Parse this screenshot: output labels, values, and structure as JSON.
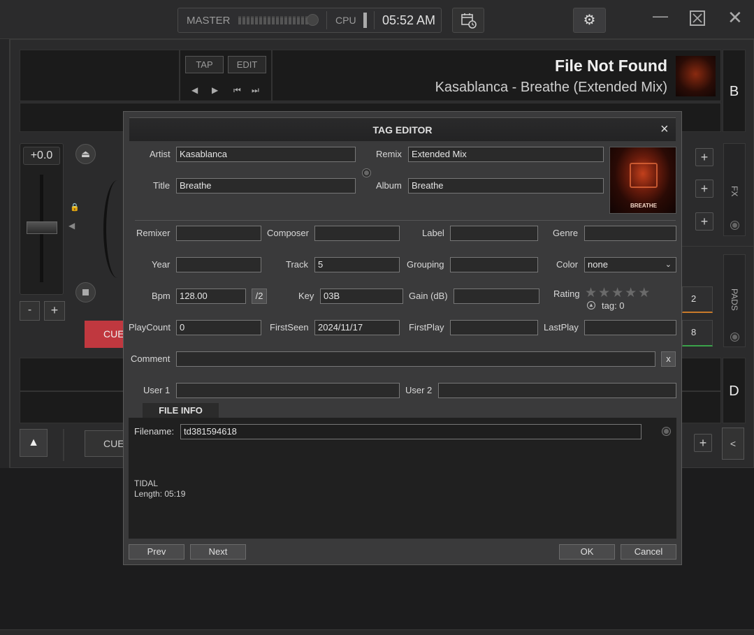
{
  "topbar": {
    "master_label": "MASTER",
    "cpu_label": "CPU",
    "clock": "05:52 AM",
    "icons": [
      "calendar-clock-icon",
      "gear-icon",
      "minimize-icon",
      "restore-icon",
      "close-icon"
    ]
  },
  "deck_top": {
    "tap_label": "TAP",
    "edit_label": "EDIT",
    "track_title": "File Not Found",
    "track_subtitle": "Kasablanca - Breathe (Extended Mix)",
    "deck_letter": "B",
    "pitch_value": "+0.0",
    "cue_label": "CUE",
    "minus_label": "-",
    "plus_label": "+"
  },
  "right_panel": {
    "fx_label": "FX",
    "pads_label": "PADS",
    "pad_2": "2",
    "pad_8": "8"
  },
  "deck_bottom": {
    "deck_letter": "D",
    "cue_label": "CUE",
    "collapse_label": "<"
  },
  "dialog": {
    "title": "TAG EDITOR",
    "close_label": "×",
    "artwork_text": "BREATHE",
    "fields": {
      "artist": {
        "label": "Artist",
        "value": "Kasablanca"
      },
      "title": {
        "label": "Title",
        "value": "Breathe"
      },
      "remix": {
        "label": "Remix",
        "value": "Extended Mix"
      },
      "album": {
        "label": "Album",
        "value": "Breathe"
      },
      "remixer": {
        "label": "Remixer",
        "value": ""
      },
      "composer": {
        "label": "Composer",
        "value": ""
      },
      "label": {
        "label": "Label",
        "value": ""
      },
      "genre": {
        "label": "Genre",
        "value": ""
      },
      "year": {
        "label": "Year",
        "value": ""
      },
      "track": {
        "label": "Track",
        "value": "5"
      },
      "grouping": {
        "label": "Grouping",
        "value": ""
      },
      "color": {
        "label": "Color",
        "value": "none"
      },
      "bpm": {
        "label": "Bpm",
        "value": "128.00",
        "half_button": "/2"
      },
      "key": {
        "label": "Key",
        "value": "03B"
      },
      "gain": {
        "label": "Gain (dB)",
        "value": ""
      },
      "rating": {
        "label": "Rating",
        "stars": 0,
        "tag_text": "tag: 0"
      },
      "playcount": {
        "label": "PlayCount",
        "value": "0"
      },
      "firstseen": {
        "label": "FirstSeen",
        "value": "2024/11/17"
      },
      "firstplay": {
        "label": "FirstPlay",
        "value": ""
      },
      "lastplay": {
        "label": "LastPlay",
        "value": ""
      },
      "comment": {
        "label": "Comment",
        "value": "",
        "clear_button": "x"
      },
      "user1": {
        "label": "User 1",
        "value": ""
      },
      "user2": {
        "label": "User 2",
        "value": ""
      }
    },
    "file_info": {
      "tab_label": "FILE INFO",
      "filename_label": "Filename:",
      "filename_value": "td381594618",
      "source": "TIDAL",
      "length": "Length: 05:19"
    },
    "buttons": {
      "prev": "Prev",
      "next": "Next",
      "ok": "OK",
      "cancel": "Cancel"
    }
  }
}
